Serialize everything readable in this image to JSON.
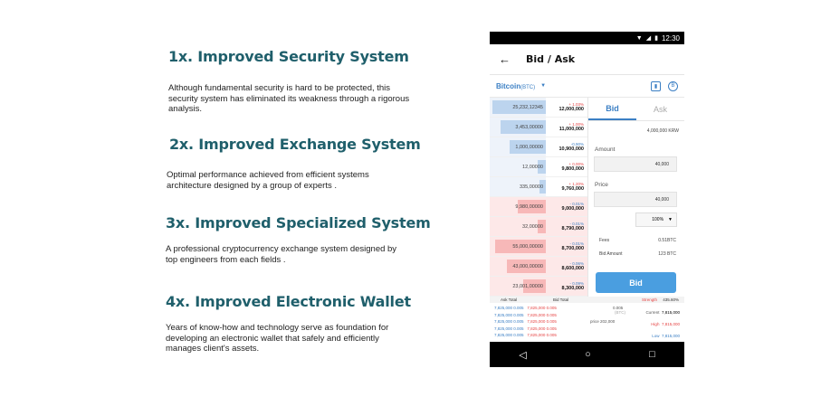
{
  "features": [
    {
      "title": "1x. Improved Security System",
      "text": "Although fundamental security is hard to be protected, this security system has eliminated its weakness through a rigorous analysis."
    },
    {
      "title": "2x. Improved Exchange System",
      "text": "Optimal performance achieved from efficient systems architecture designed by a group of experts ."
    },
    {
      "title": "3x. Improved Specialized System",
      "text": "A professional cryptocurrency exchange system designed by top engineers from each fields ."
    },
    {
      "title": "4x. Improved Electronic Wallet",
      "text": "Years of know-how and technology serve as foundation for developing an electronic wallet that safely and efficiently manages client's assets."
    }
  ],
  "phone": {
    "status_time": "12:30",
    "header_title": "Bid  /  Ask",
    "coin": "Bitcoin",
    "coin_code": "(BTC)",
    "orderbook": [
      {
        "vol": "25,232,12345",
        "chg": "+ 1.03%",
        "price": "12,000,000",
        "side": "ask",
        "fill": 0.95
      },
      {
        "vol": "3,453,00000",
        "chg": "+ 1.00%",
        "price": "11,000,000",
        "side": "ask",
        "fill": 0.8
      },
      {
        "vol": "1,000,00000",
        "chg": "-0.90%",
        "price": "10,900,000",
        "side": "ask",
        "fill": 0.65
      },
      {
        "vol": "12,00000",
        "chg": "+ 0.00%",
        "price": "9,800,000",
        "side": "ask",
        "fill": 0.15
      },
      {
        "vol": "335,00000",
        "chg": "+ 1.20%",
        "price": "9,760,000",
        "side": "ask",
        "fill": 0.12
      },
      {
        "vol": "9,980,00000",
        "chg": "- 0.01%",
        "price": "9,000,000",
        "side": "bid",
        "fill": 0.5
      },
      {
        "vol": "32,00000",
        "chg": "- 0.01%",
        "price": "8,790,000",
        "side": "bid",
        "fill": 0.15
      },
      {
        "vol": "55,000,00000",
        "chg": "- 0.01%",
        "price": "8,700,000",
        "side": "bid",
        "fill": 0.9
      },
      {
        "vol": "43,000,00000",
        "chg": "- 0.06%",
        "price": "8,600,000",
        "side": "bid",
        "fill": 0.7
      },
      {
        "vol": "23,001,00000",
        "chg": "- 0.09%",
        "price": "8,300,000",
        "side": "bid",
        "fill": 0.4
      }
    ],
    "tab_bid": "Bid",
    "tab_ask": "Ask",
    "balance": "4,000,000 KRW",
    "amount_label": "Amount",
    "amount_value": "40,000",
    "price_label": "Price",
    "price_value": "40,000",
    "percent": "100%",
    "fees_label": "Fees",
    "fees_value": "0.51BTC",
    "bid_amount_label": "Bid Amount",
    "bid_amount_value": "123 BTC",
    "bid_button": "Bid",
    "ask_total": "Ask Total",
    "bid_total": "Bid Total",
    "strength_label": "Strength",
    "strength_value": "435.60%",
    "totals_rows": [
      {
        "a": "7,825,000",
        "b": "0.005",
        "c": "7,825,000",
        "d": "0.005"
      },
      {
        "a": "7,825,000",
        "b": "0.005",
        "c": "7,825,000",
        "d": "0.005"
      },
      {
        "a": "7,825,000",
        "b": "0.005",
        "c": "7,825,000",
        "d": "0.005"
      },
      {
        "a": "7,825,000",
        "b": "0.005",
        "c": "7,825,000",
        "d": "0.005"
      },
      {
        "a": "7,825,000",
        "b": "0.005",
        "c": "7,825,000",
        "d": "0.005"
      }
    ],
    "mid_value": "0.005",
    "mid_sub": "(BTC)",
    "price_word": "price",
    "price_num": "202,000",
    "current_label": "Current",
    "current_value": "7,815,000",
    "high_label": "High",
    "high_value": "7,815,000",
    "low_label": "Low",
    "low_value": "7,815,000"
  }
}
